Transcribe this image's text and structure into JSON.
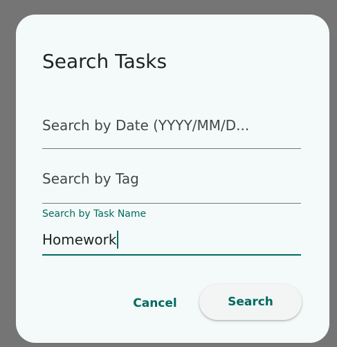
{
  "dialog": {
    "title": "Search Tasks",
    "fields": {
      "date": {
        "placeholder": "Search by Date (YYYY/MM/D...",
        "value": ""
      },
      "tag": {
        "placeholder": "Search by Tag",
        "value": ""
      },
      "name": {
        "label": "Search by Task Name",
        "value": "Homework"
      }
    },
    "buttons": {
      "cancel_label": "Cancel",
      "search_label": "Search"
    }
  },
  "colors": {
    "accent": "#006a60",
    "surface": "#f4faf9",
    "scrim": "#757575"
  }
}
